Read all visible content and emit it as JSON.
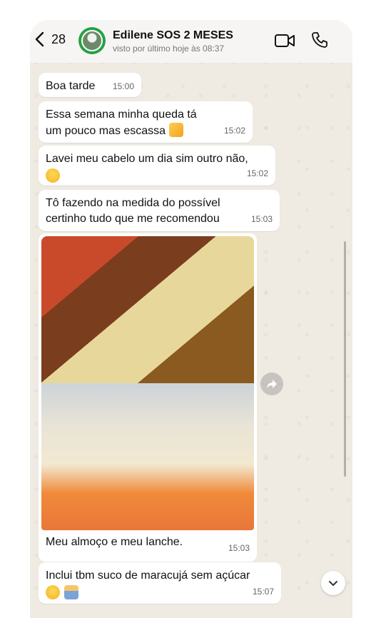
{
  "header": {
    "back_count": "28",
    "contact_name": "Edilene SOS 2 MESES",
    "status": "visto por último hoje às 08:37"
  },
  "messages": [
    {
      "text": "Boa tarde",
      "time": "15:00"
    },
    {
      "text": "Essa semana minha queda tá\num pouco mas escassa ",
      "time": "15:02"
    },
    {
      "text": "Lavei meu cabelo um dia sim outro não,",
      "time": "15:02"
    },
    {
      "text": "Tô fazendo na medida do possível\ncertinho tudo que me recomendou",
      "time": "15:03"
    },
    {
      "text": "Inclui tbm suco de maracujá sem açúcar",
      "time": "15:07"
    }
  ],
  "photo_message": {
    "caption": "Meu almoço  e meu lanche.",
    "time": "15:03"
  },
  "icons": {
    "back": "chevron-left-icon",
    "video": "video-camera-icon",
    "call": "phone-icon",
    "forward": "forward-icon",
    "scroll_down": "chevron-down-icon"
  },
  "colors": {
    "chat_background": "#efeae2",
    "bubble": "#ffffff",
    "header": "#f6f5f3",
    "avatar_ring": "#25a244"
  }
}
